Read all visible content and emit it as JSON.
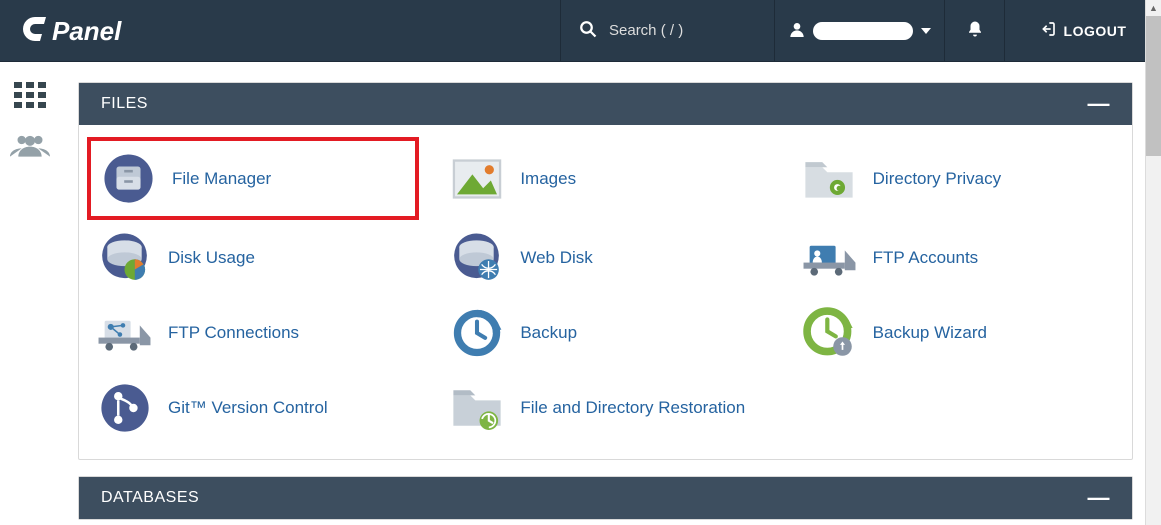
{
  "brand": "cPanel",
  "header": {
    "search_placeholder": "Search ( / )",
    "logout_label": "LOGOUT"
  },
  "panels": {
    "files": {
      "title": "FILES",
      "items": [
        {
          "label": "File Manager",
          "highlight": true
        },
        {
          "label": "Images"
        },
        {
          "label": "Directory Privacy"
        },
        {
          "label": "Disk Usage"
        },
        {
          "label": "Web Disk"
        },
        {
          "label": "FTP Accounts"
        },
        {
          "label": "FTP Connections"
        },
        {
          "label": "Backup"
        },
        {
          "label": "Backup Wizard"
        },
        {
          "label": "Git™ Version Control"
        },
        {
          "label": "File and Directory Restoration"
        }
      ]
    },
    "databases": {
      "title": "DATABASES"
    }
  },
  "colors": {
    "topbar_bg": "#293a4a",
    "panel_header_bg": "#3d4e5f",
    "link": "#2563a0",
    "highlight": "#e31b23"
  }
}
